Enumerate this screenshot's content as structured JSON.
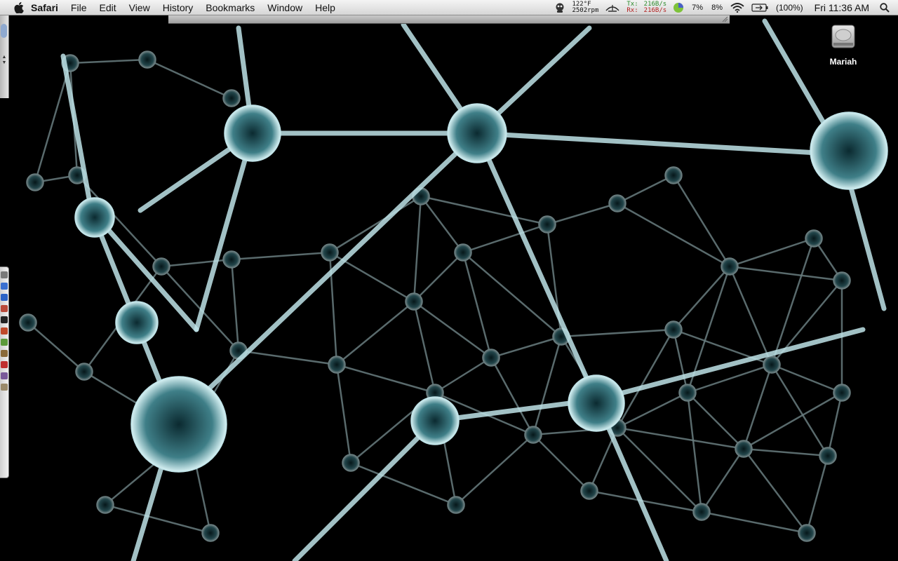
{
  "menubar": {
    "app_name": "Safari",
    "menus": [
      "File",
      "Edit",
      "View",
      "History",
      "Bookmarks",
      "Window",
      "Help"
    ],
    "temp": "122°F",
    "fan": "2502rpm",
    "tx_label": "Tx:",
    "tx_value": "216B/s",
    "rx_label": "Rx:",
    "rx_value": "216B/s",
    "cpu1": "7%",
    "cpu2": "8%",
    "battery": "(100%)",
    "clock": "Fri 11:36 AM"
  },
  "desktop": {
    "drive_label": "Mariah"
  },
  "colors": {
    "neuron": "#bfe3e8",
    "background": "#000000"
  }
}
